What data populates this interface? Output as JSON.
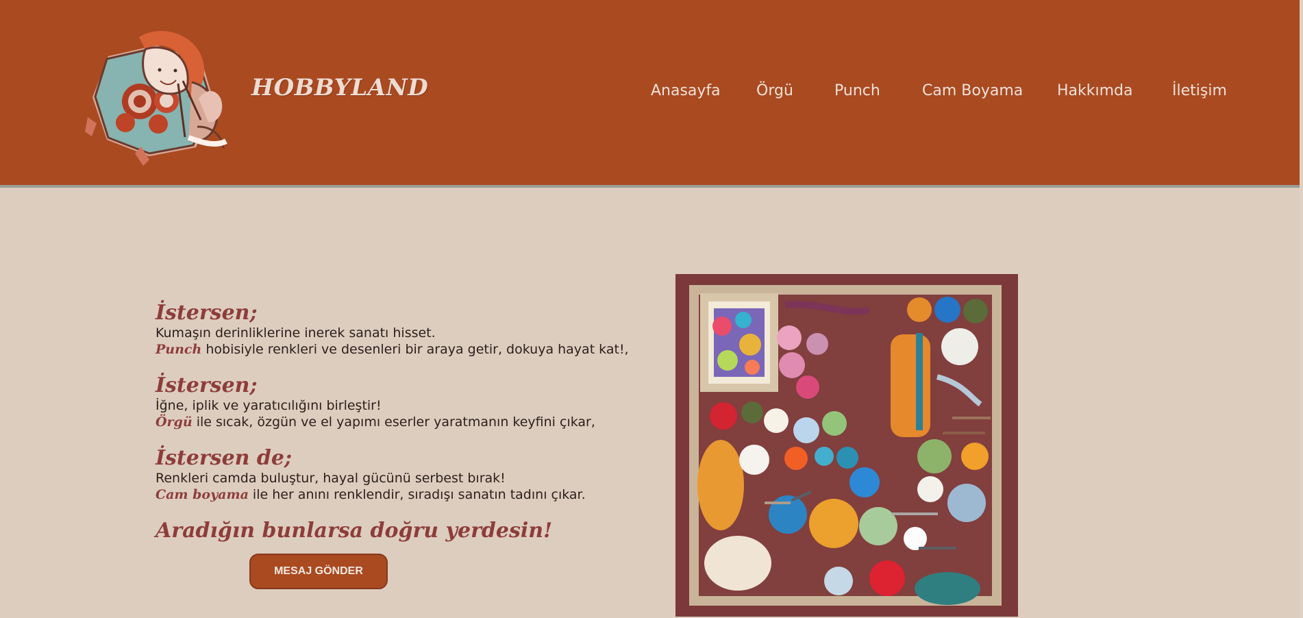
{
  "site": {
    "brand": "HOBBYLAND"
  },
  "nav": {
    "items": [
      "Anasayfa",
      "Örgü",
      "Punch",
      "Cam Boyama",
      "Hakkımda",
      "İletişim"
    ]
  },
  "hero": {
    "sections": [
      {
        "heading": "İstersen;",
        "line1": "Kumaşın derinliklerine inerek sanatı hisset.",
        "emphasis": "Punch",
        "line2_rest": " hobisiyle renkleri ve desenleri bir araya getir, dokuya hayat kat!,"
      },
      {
        "heading": "İstersen;",
        "line1": "İğne, iplik ve yaratıcılığını birleştir!",
        "emphasis": "Örgü",
        "line2_rest": " ile sıcak, özgün ve el yapımı eserler yaratmanın keyfini çıkar,"
      },
      {
        "heading": "İstersen de;",
        "line1": "Renkleri camda buluştur, hayal gücünü serbest bırak!",
        "emphasis": "Cam boyama",
        "line2_rest": " ile her anını renklendir, sıradışı sanatın tadını çıkar."
      }
    ],
    "closing": "Aradığın bunlarsa doğru yerdesin!",
    "cta_label": "MESAJ GÖNDER"
  },
  "colors": {
    "header": "#a94a21",
    "background": "#ddcdbf",
    "accent": "#8d3d39"
  },
  "icons": {
    "logo": "woman-knitting-logo",
    "hero_image": "yarn-and-craft-tools-illustration"
  }
}
